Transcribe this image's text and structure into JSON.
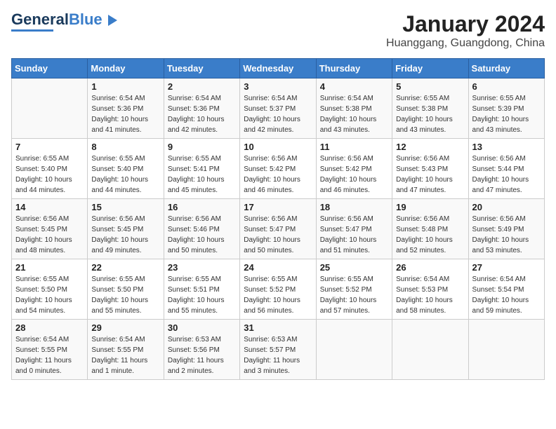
{
  "header": {
    "logo_general": "General",
    "logo_blue": "Blue",
    "title": "January 2024",
    "subtitle": "Huanggang, Guangdong, China"
  },
  "days_of_week": [
    "Sunday",
    "Monday",
    "Tuesday",
    "Wednesday",
    "Thursday",
    "Friday",
    "Saturday"
  ],
  "weeks": [
    [
      {
        "num": "",
        "sunrise": "",
        "sunset": "",
        "daylight": ""
      },
      {
        "num": "1",
        "sunrise": "Sunrise: 6:54 AM",
        "sunset": "Sunset: 5:36 PM",
        "daylight": "Daylight: 10 hours and 41 minutes."
      },
      {
        "num": "2",
        "sunrise": "Sunrise: 6:54 AM",
        "sunset": "Sunset: 5:36 PM",
        "daylight": "Daylight: 10 hours and 42 minutes."
      },
      {
        "num": "3",
        "sunrise": "Sunrise: 6:54 AM",
        "sunset": "Sunset: 5:37 PM",
        "daylight": "Daylight: 10 hours and 42 minutes."
      },
      {
        "num": "4",
        "sunrise": "Sunrise: 6:54 AM",
        "sunset": "Sunset: 5:38 PM",
        "daylight": "Daylight: 10 hours and 43 minutes."
      },
      {
        "num": "5",
        "sunrise": "Sunrise: 6:55 AM",
        "sunset": "Sunset: 5:38 PM",
        "daylight": "Daylight: 10 hours and 43 minutes."
      },
      {
        "num": "6",
        "sunrise": "Sunrise: 6:55 AM",
        "sunset": "Sunset: 5:39 PM",
        "daylight": "Daylight: 10 hours and 43 minutes."
      }
    ],
    [
      {
        "num": "7",
        "sunrise": "Sunrise: 6:55 AM",
        "sunset": "Sunset: 5:40 PM",
        "daylight": "Daylight: 10 hours and 44 minutes."
      },
      {
        "num": "8",
        "sunrise": "Sunrise: 6:55 AM",
        "sunset": "Sunset: 5:40 PM",
        "daylight": "Daylight: 10 hours and 44 minutes."
      },
      {
        "num": "9",
        "sunrise": "Sunrise: 6:55 AM",
        "sunset": "Sunset: 5:41 PM",
        "daylight": "Daylight: 10 hours and 45 minutes."
      },
      {
        "num": "10",
        "sunrise": "Sunrise: 6:56 AM",
        "sunset": "Sunset: 5:42 PM",
        "daylight": "Daylight: 10 hours and 46 minutes."
      },
      {
        "num": "11",
        "sunrise": "Sunrise: 6:56 AM",
        "sunset": "Sunset: 5:42 PM",
        "daylight": "Daylight: 10 hours and 46 minutes."
      },
      {
        "num": "12",
        "sunrise": "Sunrise: 6:56 AM",
        "sunset": "Sunset: 5:43 PM",
        "daylight": "Daylight: 10 hours and 47 minutes."
      },
      {
        "num": "13",
        "sunrise": "Sunrise: 6:56 AM",
        "sunset": "Sunset: 5:44 PM",
        "daylight": "Daylight: 10 hours and 47 minutes."
      }
    ],
    [
      {
        "num": "14",
        "sunrise": "Sunrise: 6:56 AM",
        "sunset": "Sunset: 5:45 PM",
        "daylight": "Daylight: 10 hours and 48 minutes."
      },
      {
        "num": "15",
        "sunrise": "Sunrise: 6:56 AM",
        "sunset": "Sunset: 5:45 PM",
        "daylight": "Daylight: 10 hours and 49 minutes."
      },
      {
        "num": "16",
        "sunrise": "Sunrise: 6:56 AM",
        "sunset": "Sunset: 5:46 PM",
        "daylight": "Daylight: 10 hours and 50 minutes."
      },
      {
        "num": "17",
        "sunrise": "Sunrise: 6:56 AM",
        "sunset": "Sunset: 5:47 PM",
        "daylight": "Daylight: 10 hours and 50 minutes."
      },
      {
        "num": "18",
        "sunrise": "Sunrise: 6:56 AM",
        "sunset": "Sunset: 5:47 PM",
        "daylight": "Daylight: 10 hours and 51 minutes."
      },
      {
        "num": "19",
        "sunrise": "Sunrise: 6:56 AM",
        "sunset": "Sunset: 5:48 PM",
        "daylight": "Daylight: 10 hours and 52 minutes."
      },
      {
        "num": "20",
        "sunrise": "Sunrise: 6:56 AM",
        "sunset": "Sunset: 5:49 PM",
        "daylight": "Daylight: 10 hours and 53 minutes."
      }
    ],
    [
      {
        "num": "21",
        "sunrise": "Sunrise: 6:55 AM",
        "sunset": "Sunset: 5:50 PM",
        "daylight": "Daylight: 10 hours and 54 minutes."
      },
      {
        "num": "22",
        "sunrise": "Sunrise: 6:55 AM",
        "sunset": "Sunset: 5:50 PM",
        "daylight": "Daylight: 10 hours and 55 minutes."
      },
      {
        "num": "23",
        "sunrise": "Sunrise: 6:55 AM",
        "sunset": "Sunset: 5:51 PM",
        "daylight": "Daylight: 10 hours and 55 minutes."
      },
      {
        "num": "24",
        "sunrise": "Sunrise: 6:55 AM",
        "sunset": "Sunset: 5:52 PM",
        "daylight": "Daylight: 10 hours and 56 minutes."
      },
      {
        "num": "25",
        "sunrise": "Sunrise: 6:55 AM",
        "sunset": "Sunset: 5:52 PM",
        "daylight": "Daylight: 10 hours and 57 minutes."
      },
      {
        "num": "26",
        "sunrise": "Sunrise: 6:54 AM",
        "sunset": "Sunset: 5:53 PM",
        "daylight": "Daylight: 10 hours and 58 minutes."
      },
      {
        "num": "27",
        "sunrise": "Sunrise: 6:54 AM",
        "sunset": "Sunset: 5:54 PM",
        "daylight": "Daylight: 10 hours and 59 minutes."
      }
    ],
    [
      {
        "num": "28",
        "sunrise": "Sunrise: 6:54 AM",
        "sunset": "Sunset: 5:55 PM",
        "daylight": "Daylight: 11 hours and 0 minutes."
      },
      {
        "num": "29",
        "sunrise": "Sunrise: 6:54 AM",
        "sunset": "Sunset: 5:55 PM",
        "daylight": "Daylight: 11 hours and 1 minute."
      },
      {
        "num": "30",
        "sunrise": "Sunrise: 6:53 AM",
        "sunset": "Sunset: 5:56 PM",
        "daylight": "Daylight: 11 hours and 2 minutes."
      },
      {
        "num": "31",
        "sunrise": "Sunrise: 6:53 AM",
        "sunset": "Sunset: 5:57 PM",
        "daylight": "Daylight: 11 hours and 3 minutes."
      },
      {
        "num": "",
        "sunrise": "",
        "sunset": "",
        "daylight": ""
      },
      {
        "num": "",
        "sunrise": "",
        "sunset": "",
        "daylight": ""
      },
      {
        "num": "",
        "sunrise": "",
        "sunset": "",
        "daylight": ""
      }
    ]
  ]
}
